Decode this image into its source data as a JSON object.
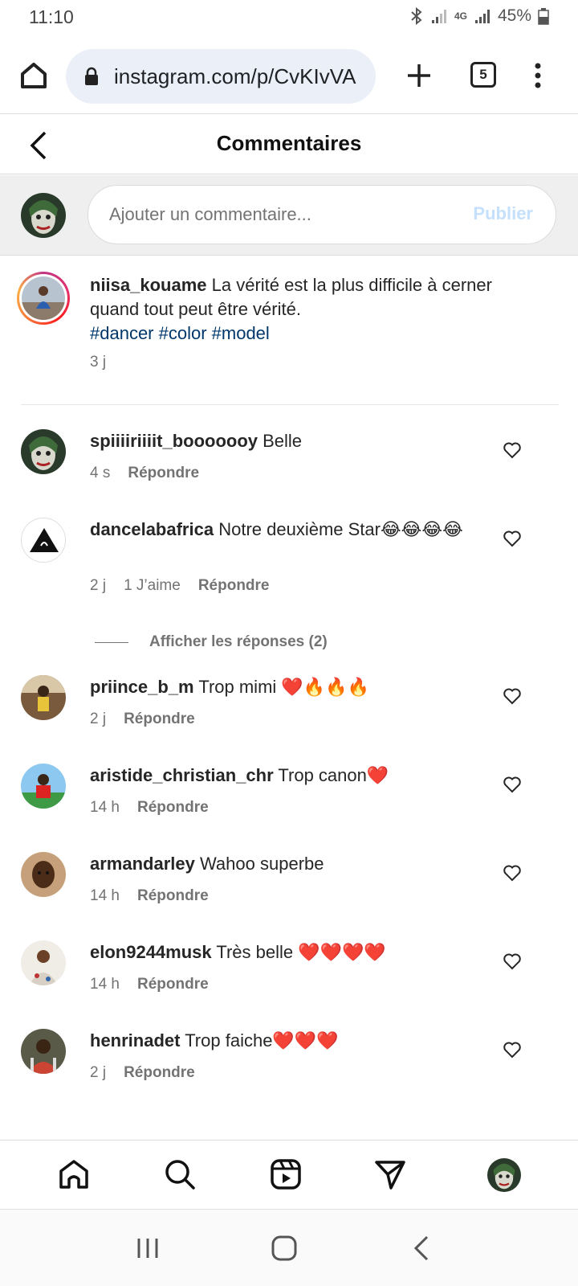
{
  "status_bar": {
    "time": "11:10",
    "network": "4G",
    "battery": "45%"
  },
  "browser": {
    "url": "instagram.com/p/CvKIvVA",
    "tab_count": "5"
  },
  "header": {
    "title": "Commentaires"
  },
  "composer": {
    "placeholder": "Ajouter un commentaire...",
    "publish_label": "Publier"
  },
  "caption": {
    "username": "niisa_kouame",
    "text": "La vérité est la plus difficile à cerner quand tout peut être vérité.",
    "hashtags": "#dancer #color #model",
    "time": "3 j"
  },
  "comments": [
    {
      "username": "spiiiiriiiit_booooooy",
      "text": "Belle",
      "time": "4 s",
      "likes": "",
      "reply": "Répondre"
    },
    {
      "username": "dancelabafrica",
      "text": "Notre deuxième Star😂😂😂😂",
      "time": "2 j",
      "likes": "1 J’aime",
      "reply": "Répondre"
    },
    {
      "username": "priince_b_m",
      "text": "Trop mimi ❤️🔥🔥🔥",
      "time": "2 j",
      "likes": "",
      "reply": "Répondre"
    },
    {
      "username": "aristide_christian_chr",
      "text": "Trop canon❤️",
      "time": "14 h",
      "likes": "",
      "reply": "Répondre"
    },
    {
      "username": "armandarley",
      "text": "Wahoo superbe",
      "time": "14 h",
      "likes": "",
      "reply": "Répondre"
    },
    {
      "username": "elon9244musk",
      "text": "Très belle ❤️❤️❤️❤️",
      "time": "14 h",
      "likes": "",
      "reply": "Répondre"
    },
    {
      "username": "henrinadet",
      "text": "Trop faiche❤️❤️❤️",
      "time": "2 j",
      "likes": "",
      "reply": "Répondre"
    }
  ],
  "view_replies": "Afficher les réponses (2)",
  "icons": [
    "home-icon",
    "search-icon",
    "reels-icon",
    "direct-icon",
    "profile-avatar"
  ],
  "colors": {
    "link_blue": "#00376b",
    "publish_disabled": "#c4e0fc",
    "meta_gray": "#737373"
  }
}
